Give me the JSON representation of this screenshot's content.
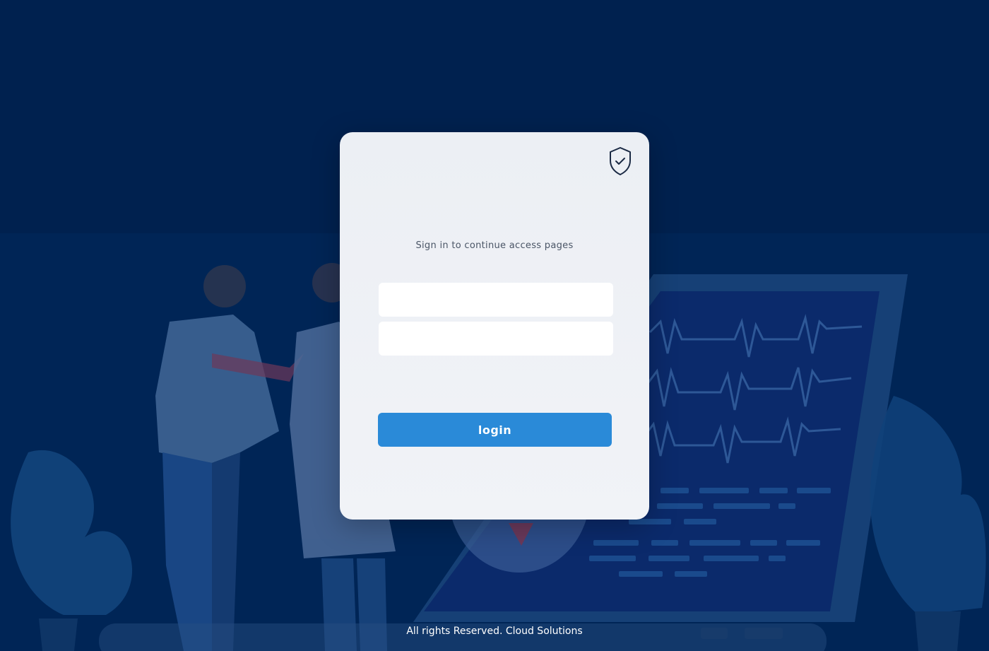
{
  "login": {
    "subtitle": "Sign in to continue access pages",
    "username_placeholder": "",
    "password_placeholder": "",
    "submit_label": "login"
  },
  "footer": {
    "text": "All rights Reserved. Cloud Solutions"
  },
  "icons": {
    "badge": "shield-check-icon"
  },
  "colors": {
    "background": "#00214f",
    "card": "#eef1f5",
    "primary_button": "#2a8ad8"
  }
}
